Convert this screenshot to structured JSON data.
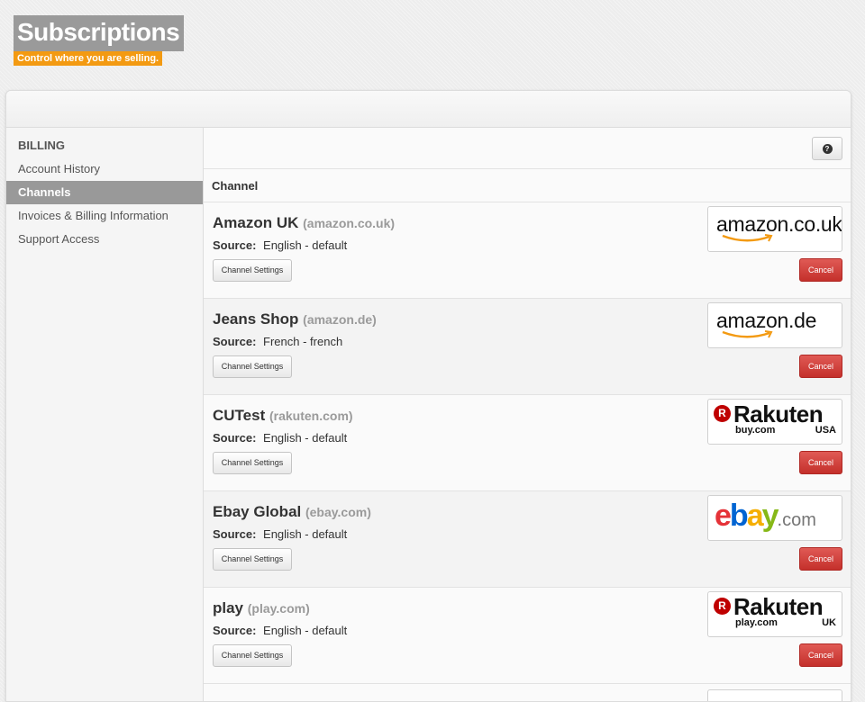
{
  "header": {
    "title": "Subscriptions",
    "subtitle": "Control where you are selling."
  },
  "sidebar": {
    "heading": "BILLING",
    "items": [
      {
        "label": "Account History",
        "active": false
      },
      {
        "label": "Channels",
        "active": true
      },
      {
        "label": "Invoices & Billing Information",
        "active": false
      },
      {
        "label": "Support Access",
        "active": false
      }
    ]
  },
  "toolbar": {
    "help_icon": "question-icon",
    "help_glyph": "?"
  },
  "table": {
    "column_header": "Channel"
  },
  "channels": [
    {
      "name": "Amazon UK",
      "domain": "(amazon.co.uk)",
      "source_label": "Source:",
      "source_value": "English - default",
      "settings_label": "Channel Settings",
      "cancel_label": "Cancel",
      "logo": {
        "type": "amazon",
        "word": "amazon",
        "suffix": ".co.uk"
      }
    },
    {
      "name": "Jeans Shop",
      "domain": "(amazon.de)",
      "source_label": "Source:",
      "source_value": "French - french",
      "settings_label": "Channel Settings",
      "cancel_label": "Cancel",
      "logo": {
        "type": "amazon",
        "word": "amazon",
        "suffix": ".de"
      }
    },
    {
      "name": "CUTest",
      "domain": "(rakuten.com)",
      "source_label": "Source:",
      "source_value": "English - default",
      "settings_label": "Channel Settings",
      "cancel_label": "Cancel",
      "logo": {
        "type": "rakuten",
        "letter": "R",
        "word": "Rakuten",
        "sub": "buy.com",
        "region": "USA"
      }
    },
    {
      "name": "Ebay Global",
      "domain": "(ebay.com)",
      "source_label": "Source:",
      "source_value": "English - default",
      "settings_label": "Channel Settings",
      "cancel_label": "Cancel",
      "logo": {
        "type": "ebay",
        "e": "e",
        "b": "b",
        "a": "a",
        "y": "y",
        "suffix": ".com"
      }
    },
    {
      "name": "play",
      "domain": "(play.com)",
      "source_label": "Source:",
      "source_value": "English - default",
      "settings_label": "Channel Settings",
      "cancel_label": "Cancel",
      "logo": {
        "type": "rakuten",
        "letter": "R",
        "word": "Rakuten",
        "sub": "play.com",
        "region": "UK"
      }
    }
  ],
  "colors": {
    "title_bg": "#9a9a9a",
    "subtitle_bg": "#f39a12",
    "active_nav": "#999999",
    "cancel": "#d0403b",
    "amazon_smile": "#f39a12",
    "rakuten_red": "#bf0000",
    "ebay_e": "#e53238",
    "ebay_b": "#0064d2",
    "ebay_a": "#f5af02",
    "ebay_y": "#86b817"
  }
}
